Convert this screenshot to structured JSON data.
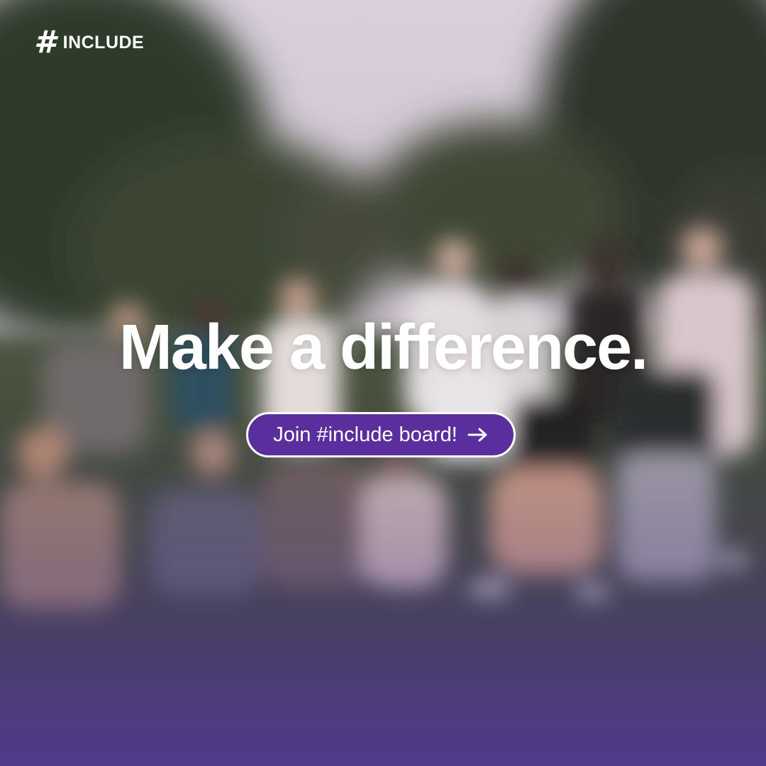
{
  "brand": {
    "mark_icon": "hashtag-icon",
    "mark_glyph": "#",
    "name": "INCLUDE"
  },
  "headline": "Make a difference.",
  "cta": {
    "label": "Join #include board!",
    "icon": "arrow-right-icon",
    "background_color": "#5b2e9e",
    "border_color": "#ffffff"
  },
  "background": {
    "description_icon": "blurred-group-photo",
    "overlay_color": "#5a3a96"
  }
}
